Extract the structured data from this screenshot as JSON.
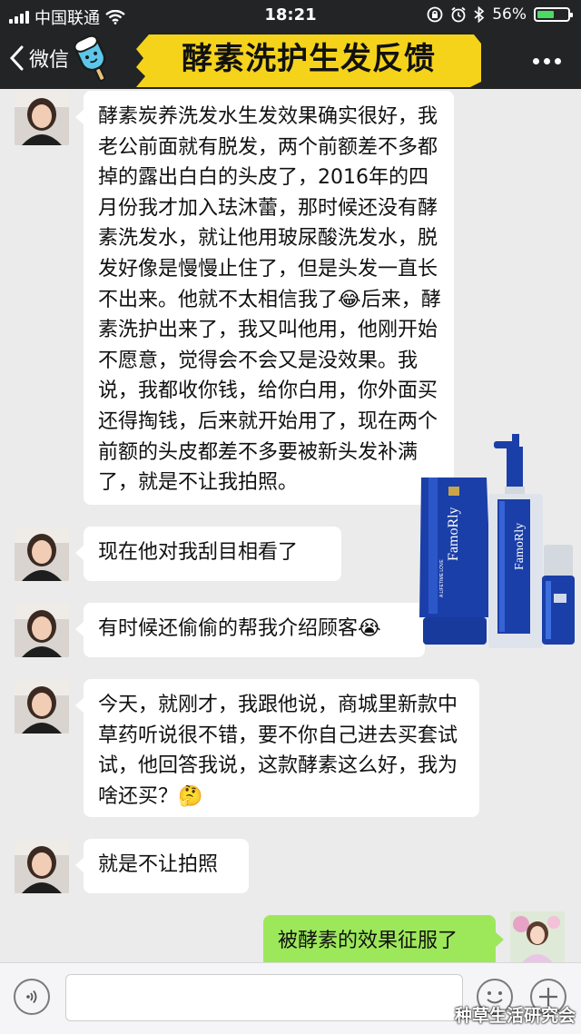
{
  "status_bar": {
    "carrier": "中国联通",
    "time": "18:21",
    "battery_percent": "56%",
    "battery_level": 0.56
  },
  "nav": {
    "back_label": "微信",
    "title": "酵素洗护生发反馈"
  },
  "messages": [
    {
      "side": "left",
      "text": "酵素炭养洗发水生发效果确实很好，我老公前面就有脱发，两个前额差不多都掉的露出白白的头皮了，2016年的四月份我才加入珐沐蕾，那时候还没有酵素洗发水，就让他用玻尿酸洗发水，脱发好像是慢慢止住了，但是头发一直长不出来。他就不太相信我了😂后来，酵素洗护出来了，我又叫他用，他刚开始不愿意，觉得会不会又是没效果。我说，我都收你钱，给你白用，你外面买还得掏钱，后来就开始用了，现在两个前额的头皮都差不多要被新头发补满了，就是不让我拍照。"
    },
    {
      "side": "left",
      "text": "现在他对我刮目相看了"
    },
    {
      "side": "left",
      "text": "有时候还偷偷的帮我介绍顾客😭"
    },
    {
      "side": "left",
      "text": "今天，就刚才，我跟他说，商城里新款中草药听说很不错，要不你自己进去买套试试，他回答我说，这款酵素这么好，我为啥还买？🤔"
    },
    {
      "side": "left",
      "text": "就是不让拍照"
    },
    {
      "side": "right",
      "text": "被酵素的效果征服了"
    }
  ],
  "product_image": {
    "brand_text": "FamoRly",
    "tube_label": "A LIFETIME LOVE"
  },
  "watermark": "种草生活研究会",
  "colors": {
    "bar_bg": "#222426",
    "chat_bg": "#ebebeb",
    "banner_yellow": "#f5d31b",
    "sent_bubble": "#9de85a",
    "product_blue": "#1b3fa8"
  }
}
